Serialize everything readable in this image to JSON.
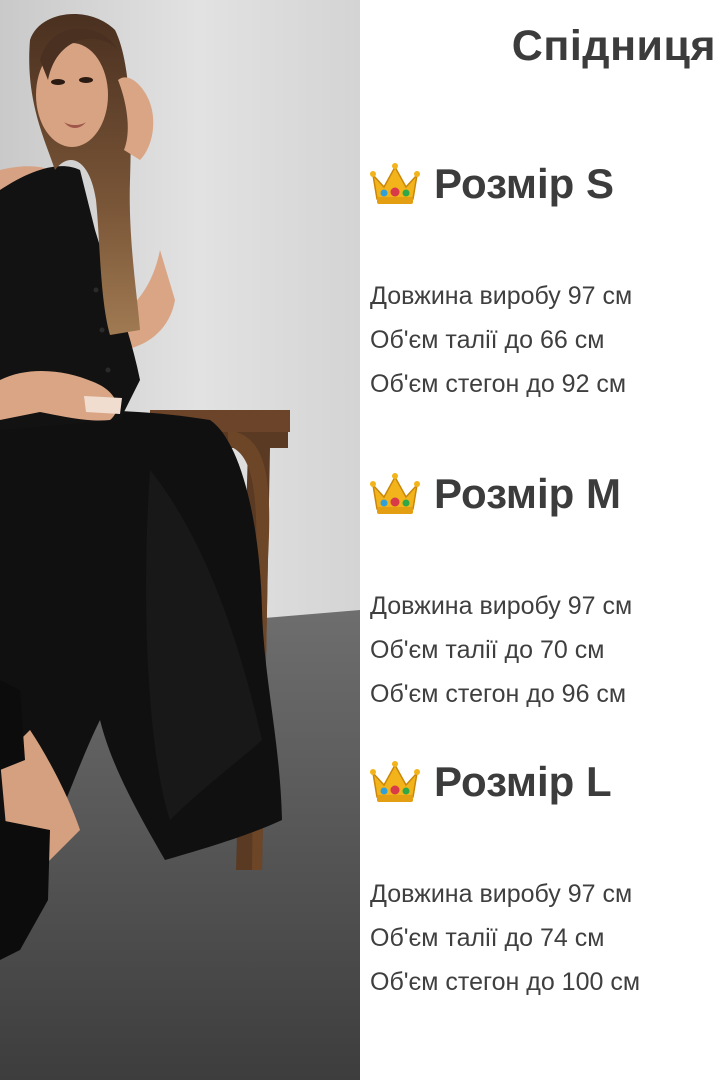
{
  "title": "Спідниця",
  "sizes": [
    {
      "icon": "crown-icon",
      "label": "Розмір S",
      "specs": [
        "Довжина виробу 97 см",
        "Об'єм талії до 66 см",
        "Об'єм стегон до 92 см"
      ]
    },
    {
      "icon": "crown-icon",
      "label": "Розмір M",
      "specs": [
        "Довжина виробу 97 см",
        "Об'єм талії до 70 см",
        "Об'єм стегон до 96 см"
      ]
    },
    {
      "icon": "crown-icon",
      "label": "Розмір L",
      "specs": [
        "Довжина виробу 97 см",
        "Об'єм талії до 74 см",
        "Об'єм стегон до 100 см"
      ]
    }
  ],
  "colors": {
    "text": "#3c3c3c",
    "garment": "#111111",
    "background_wall": "#d9d9d9",
    "crown_gold": "#f2b31b"
  }
}
